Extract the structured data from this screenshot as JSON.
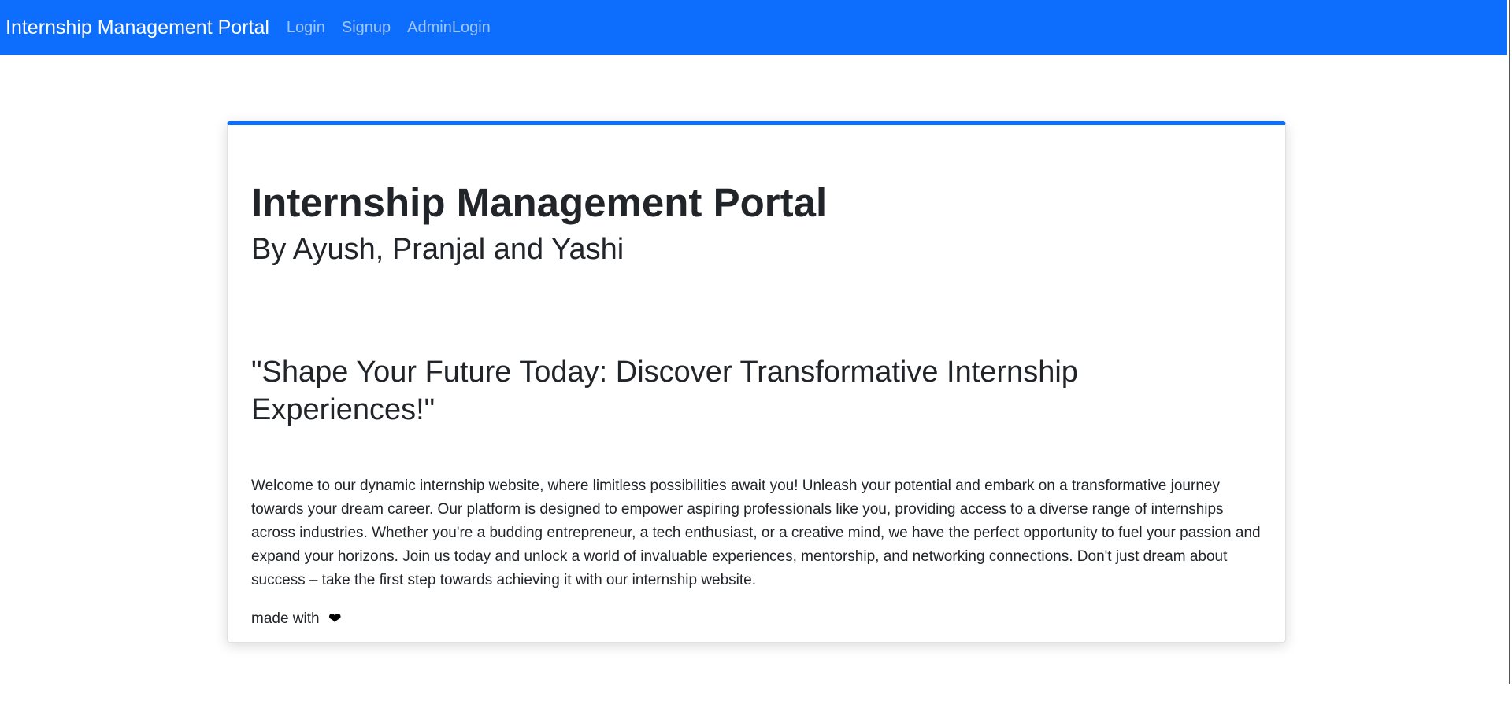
{
  "navbar": {
    "brand": "Internship Management Portal",
    "links": [
      {
        "label": "Login"
      },
      {
        "label": "Signup"
      },
      {
        "label": "AdminLogin"
      }
    ],
    "background_color": "#0d6efd"
  },
  "hero": {
    "title": "Internship Management Portal",
    "subtitle": "By Ayush, Pranjal and Yashi",
    "tagline": "\"Shape Your Future Today: Discover Transformative Internship Experiences!\"",
    "description": "Welcome to our dynamic internship website, where limitless possibilities await you! Unleash your potential and embark on a transformative journey towards your dream career. Our platform is designed to empower aspiring professionals like you, providing access to a diverse range of internships across industries. Whether you're a budding entrepreneur, a tech enthusiast, or a creative mind, we have the perfect opportunity to fuel your passion and expand your horizons. Join us today and unlock a world of invaluable experiences, mentorship, and networking connections. Don't just dream about success – take the first step towards achieving it with our internship website.",
    "footer_text": "made with",
    "footer_icon": "heart-icon",
    "accent_color": "#0d6efd"
  }
}
